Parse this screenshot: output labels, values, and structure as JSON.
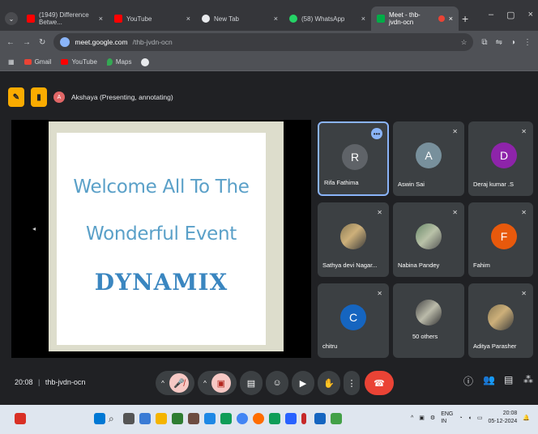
{
  "tabs": [
    {
      "label": "(1949) Difference Betwe...",
      "close": "×",
      "active": false,
      "icon": "youtube-icon"
    },
    {
      "label": "YouTube",
      "close": "×",
      "active": false,
      "icon": "youtube-icon"
    },
    {
      "label": "New Tab",
      "close": "×",
      "active": false,
      "icon": "chrome-icon"
    },
    {
      "label": "(58) WhatsApp",
      "close": "×",
      "active": false,
      "icon": "whatsapp-icon"
    },
    {
      "label": "Meet - thb-jvdn-ocn",
      "close": "×",
      "active": true,
      "icon": "meet-icon"
    }
  ],
  "new_tab": "+",
  "window_controls": {
    "minimize": "–",
    "maximize": "▢",
    "close": "×"
  },
  "address": {
    "host": "meet.google.com",
    "path": "/thb-jvdn-ocn"
  },
  "bookmarks": [
    {
      "label": "Gmail",
      "icon": "gmail-icon"
    },
    {
      "label": "YouTube",
      "icon": "youtube-icon"
    },
    {
      "label": "Maps",
      "icon": "maps-icon"
    }
  ],
  "presenter": {
    "avatar": "A",
    "text": "Akshaya (Presenting, annotating)"
  },
  "slide": {
    "line1": "Welcome All To The",
    "line2": "Wonderful Event",
    "line3": "DYNAMIX"
  },
  "participants": [
    {
      "name": "Rifa Fathima",
      "initial": "R",
      "color": "#5f6368",
      "selected": true
    },
    {
      "name": "Aswin Sai",
      "initial": "A",
      "color": "#78909c"
    },
    {
      "name": "Deraj kumar .S",
      "initial": "D",
      "color": "#8e24aa"
    },
    {
      "name": "Sathya devi Nagar...",
      "initial": "",
      "photo": true
    },
    {
      "name": "Nabina Pandey",
      "initial": "",
      "photo": true
    },
    {
      "name": "Fahim",
      "initial": "F",
      "color": "#e8590c"
    },
    {
      "name": "chitru",
      "initial": "C",
      "color": "#1565c0"
    },
    {
      "name": "50 others",
      "initial": "",
      "photo": true
    },
    {
      "name": "Aditya Parasher",
      "initial": "",
      "photo": true
    }
  ],
  "meeting": {
    "time": "20:08",
    "separator": "|",
    "code": "thb-jvdn-ocn"
  },
  "taskbar": {
    "lang": "ENG\nIN",
    "time": "20:08",
    "date": "05-12-2024"
  }
}
